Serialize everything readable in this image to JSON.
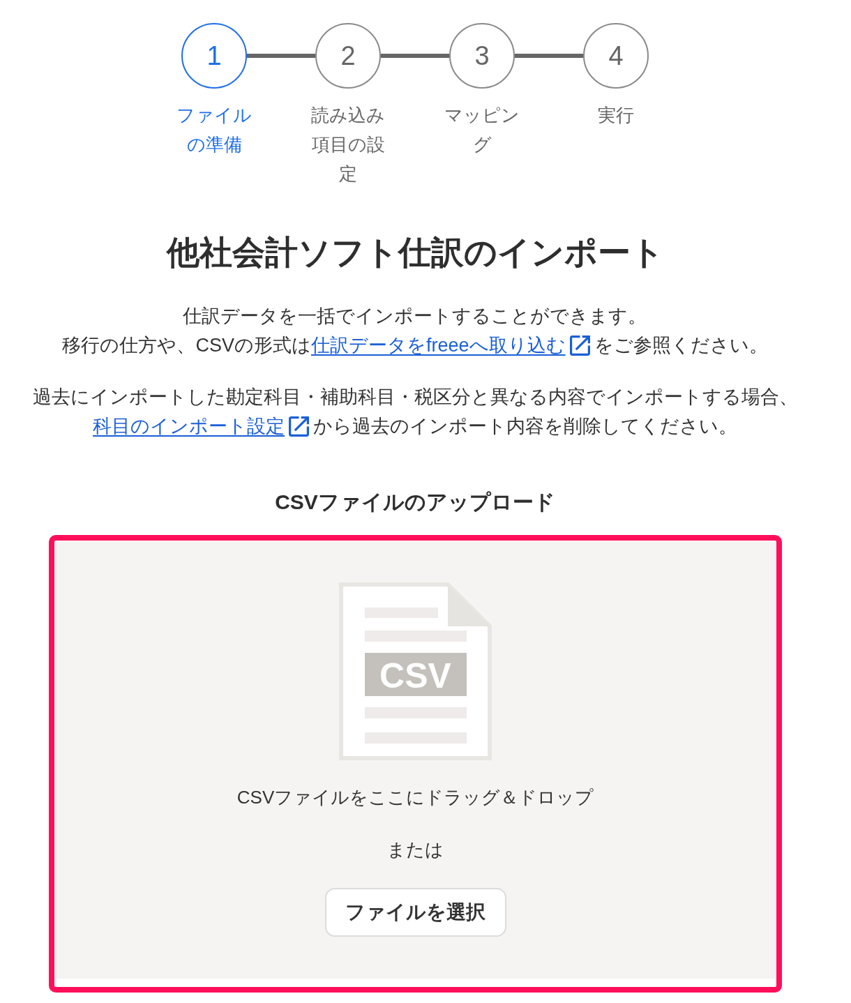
{
  "stepper": {
    "steps": [
      {
        "number": "1",
        "label": "ファイルの準備",
        "selected": true
      },
      {
        "number": "2",
        "label": "読み込み項目の設定",
        "selected": false
      },
      {
        "number": "3",
        "label": "マッピング",
        "selected": false
      },
      {
        "number": "4",
        "label": "実行",
        "selected": false
      }
    ]
  },
  "title": "他社会計ソフト仕訳のインポート",
  "paragraphs": [
    {
      "lines": [
        [
          {
            "kind": "text",
            "text": "仕訳データを一括でインポートすることができます。"
          }
        ],
        [
          {
            "kind": "text",
            "text": "移行の仕方や、CSVの形式は"
          },
          {
            "kind": "link",
            "text": "仕訳データをfreeeへ取り込む"
          },
          {
            "kind": "text",
            "text": "をご参照ください。"
          }
        ]
      ]
    },
    {
      "lines": [
        [
          {
            "kind": "text",
            "text": "過去にインポートした勘定科目・補助科目・税区分と異なる内容でインポートする場合、"
          }
        ],
        [
          {
            "kind": "link",
            "text": "科目のインポート設定"
          },
          {
            "kind": "text",
            "text": "から過去のインポート内容を削除してください。"
          }
        ]
      ]
    }
  ],
  "upload": {
    "heading": "CSVファイルのアップロード",
    "highlighted": true,
    "file_icon_label": "CSV",
    "drop_text": "CSVファイルをここにドラッグ＆ドロップ",
    "or_text": "または",
    "button": "ファイルを選択"
  }
}
